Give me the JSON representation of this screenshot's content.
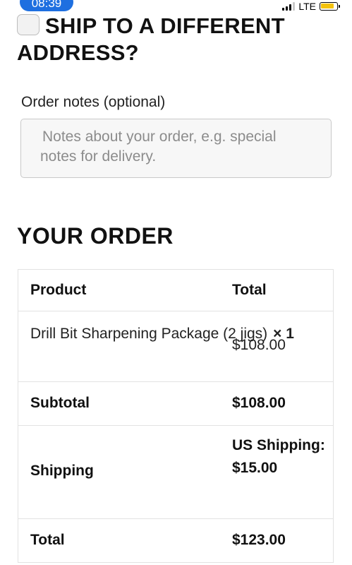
{
  "status_bar": {
    "time": "08:39",
    "network": "LTE",
    "battery_level": 0.85,
    "battery_color": "#f4c20d"
  },
  "ship_to_different": {
    "label": "SHIP TO A DIFFERENT ADDRESS?",
    "checked": false
  },
  "notes": {
    "label": "Order notes (optional)",
    "placeholder": "Notes about your order, e.g. special notes for delivery."
  },
  "order": {
    "heading": "YOUR ORDER",
    "columns": {
      "product": "Product",
      "total": "Total"
    },
    "items": [
      {
        "name": "Drill Bit Sharpening Package (2 jigs)",
        "qty": "× 1",
        "total": "$108.00"
      }
    ],
    "subtotal": {
      "label": "Subtotal",
      "value": "$108.00"
    },
    "shipping": {
      "label": "Shipping",
      "value": "US Shipping: $15.00"
    },
    "total": {
      "label": "Total",
      "value": "$123.00"
    }
  }
}
